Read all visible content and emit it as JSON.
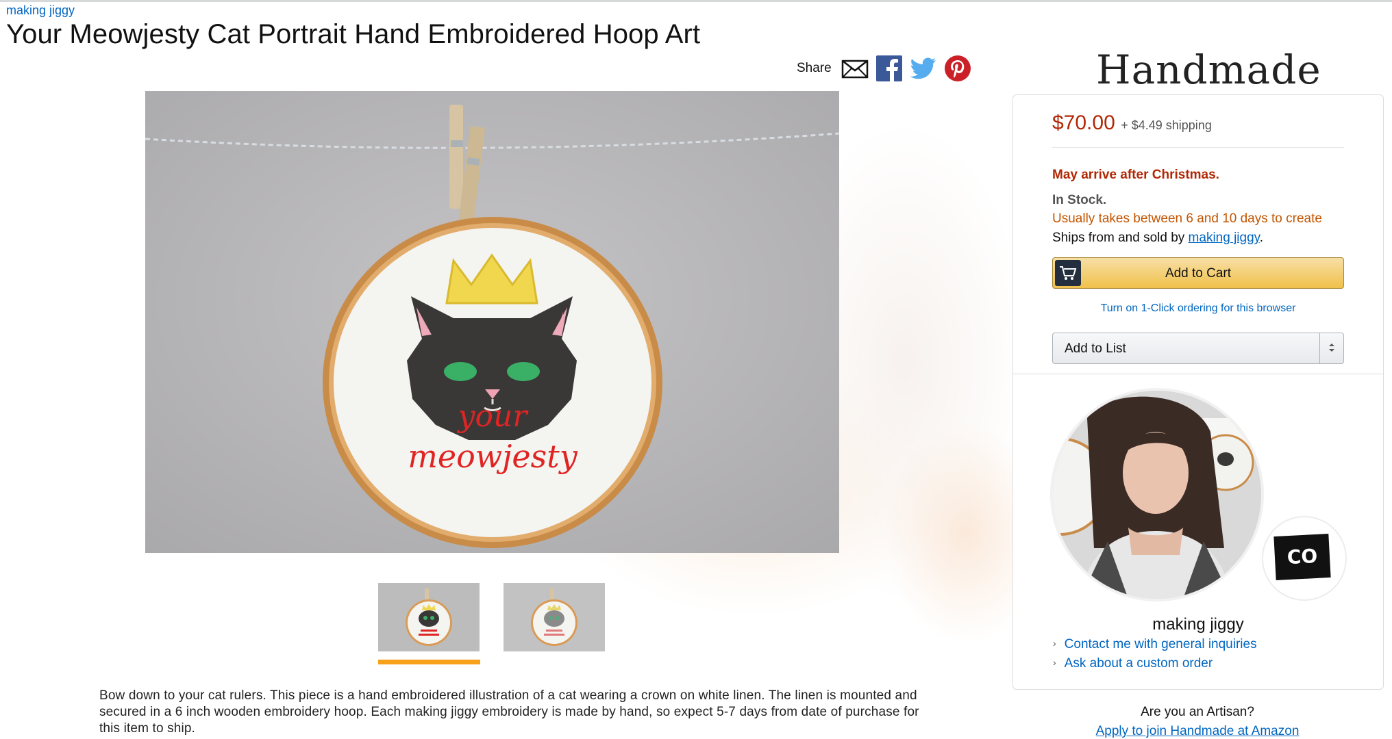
{
  "store": {
    "brand_link": "making jiggy"
  },
  "product": {
    "title": "Your Meowjesty Cat Portrait Hand Embroidered Hoop Art"
  },
  "image": {
    "hoop_text_line1": "your",
    "hoop_text_line2": "meowjesty"
  },
  "share": {
    "label": "Share",
    "icons": [
      "email-icon",
      "facebook-icon",
      "twitter-icon",
      "pinterest-icon"
    ]
  },
  "description": "Bow down to your cat rulers. This piece is a hand embroidered illustration of a cat wearing a crown on white linen. The linen is mounted and secured in a 6 inch wooden embroidery hoop. Each making jiggy embroidery is made by hand, so expect 5-7 days from date of purchase for this item to ship.",
  "header": {
    "handmade_logo": "Handmade"
  },
  "buybox": {
    "price": "$70.00",
    "shipping": "+ $4.49 shipping",
    "arrival_notice": "May arrive after Christmas.",
    "stock": "In Stock.",
    "lead_time": "Usually takes between 6 and 10 days to create",
    "ships_from_prefix": "Ships from and sold by",
    "seller_link": "making jiggy",
    "ships_from_suffix": ".",
    "add_to_cart": "Add to Cart",
    "one_click": "Turn on 1-Click ordering for this browser",
    "add_to_list": "Add to List"
  },
  "artisan": {
    "name": "making jiggy",
    "badge": "CO",
    "links": [
      "Contact me with general inquiries",
      "Ask about a custom order"
    ]
  },
  "footer": {
    "question": "Are you an Artisan?",
    "apply_link": "Apply to join Handmade at Amazon"
  },
  "colors": {
    "link": "#0066c0",
    "price": "#b12704",
    "lead_time": "#c45500",
    "cart_button": "#f0c14b",
    "thumb_selected": "#f7a01a"
  }
}
